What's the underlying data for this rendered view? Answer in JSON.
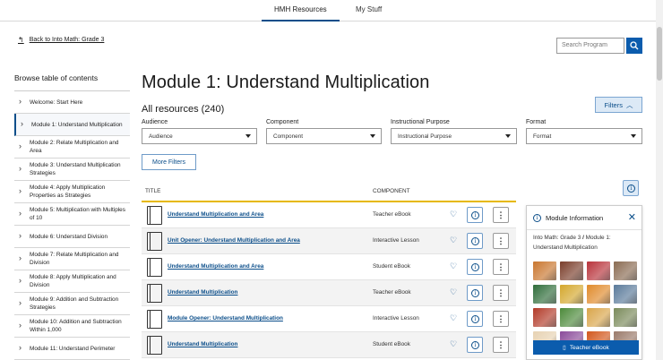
{
  "topnav": {
    "tabs": [
      {
        "label": "HMH Resources",
        "active": true
      },
      {
        "label": "My Stuff",
        "active": false
      }
    ]
  },
  "back_link": "Back to Into Math: Grade 3",
  "search": {
    "placeholder": "Search Program"
  },
  "toc": {
    "title": "Browse table of contents",
    "items": [
      "Welcome: Start Here",
      "Module 1: Understand Multiplication",
      "Module 2: Relate Multiplication and Area",
      "Module 3: Understand Multiplication Strategies",
      "Module 4: Apply Multiplication Properties as Strategies",
      "Module 5: Multiplication with Multiples of 10",
      "Module 6: Understand Division",
      "Module 7: Relate Multiplication and Division",
      "Module 8: Apply Multiplication and Division",
      "Module 9: Addition and Subtraction Strategies",
      "Module 10: Addition and Subtraction Within 1,000",
      "Module 11: Understand Perimeter"
    ],
    "active_index": 1
  },
  "main": {
    "heading": "Module 1: Understand Multiplication",
    "count": "All resources (240)",
    "filters_button": "Filters",
    "more_filters": "More Filters",
    "filters": [
      {
        "label": "Audience",
        "value": "Audience"
      },
      {
        "label": "Component",
        "value": "Component"
      },
      {
        "label": "Instructional Purpose",
        "value": "Instructional Purpose"
      },
      {
        "label": "Format",
        "value": "Format"
      }
    ]
  },
  "table": {
    "headers": {
      "title": "TITLE",
      "component": "COMPONENT"
    },
    "rows": [
      {
        "title": "Understand Multiplication and Area",
        "component": "Teacher eBook"
      },
      {
        "title": "Unit Opener: Understand Multiplication and Area",
        "component": "Interactive Lesson"
      },
      {
        "title": "Understand Multiplication and Area",
        "component": "Student eBook"
      },
      {
        "title": "Understand Multiplication",
        "component": "Teacher eBook"
      },
      {
        "title": "Module Opener: Understand Multiplication",
        "component": "Interactive Lesson"
      },
      {
        "title": "Understand Multiplication",
        "component": "Student eBook"
      }
    ]
  },
  "panel": {
    "title": "Module Information",
    "crumb_part1": "Into Math: Grade 3",
    "crumb_sep": "/",
    "crumb_part2": "Module 1: Understand Multiplication",
    "cta": "Teacher eBook",
    "thumb_colors": [
      "#c9762e",
      "#7a3d2a",
      "#b8323a",
      "#8a6b52",
      "#2f6d3a",
      "#d4a72c",
      "#e08a2a",
      "#5a7a9a",
      "#b23a28",
      "#4c8a3a",
      "#d9a54a",
      "#7a8a5a",
      "#e7d2b2",
      "#8a4a9a",
      "#d2571c",
      "#9a7a6a"
    ],
    "accent": "#0b5cad"
  }
}
